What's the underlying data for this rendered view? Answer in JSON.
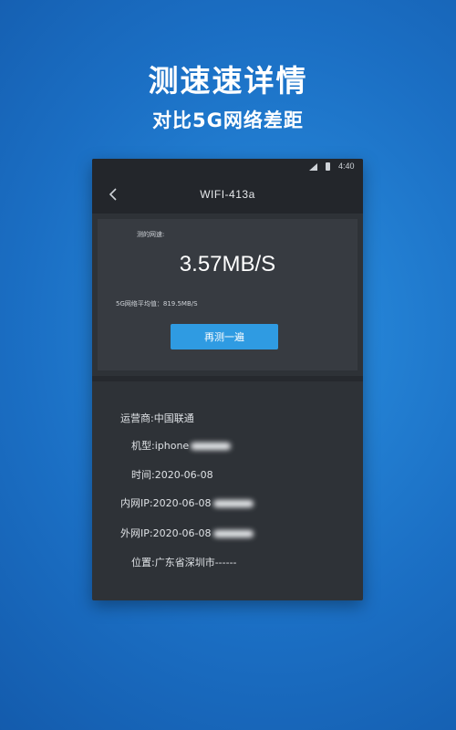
{
  "promo": {
    "title": "测速速详情",
    "subtitle": "对比5G网络差距"
  },
  "status_bar": {
    "time": "4:40"
  },
  "nav": {
    "title": "WIFI-413a"
  },
  "speed": {
    "label": "测的网速:",
    "value": "3.57MB/S",
    "avg_5g": "5G网络平均值：819.5MB/S",
    "retest_button": "再测一遍"
  },
  "info": {
    "carrier": "运营商:中国联通",
    "model": "机型:iphone",
    "time": "时间:2020-06-08",
    "lan_ip": "内网IP:2020-06-08",
    "wan_ip": "外网IP:2020-06-08",
    "location": "位置:广东省深圳市------"
  },
  "colors": {
    "accent_button": "#2f9be2",
    "panel_background": "#2e3237",
    "background_blue": "#1b6fc4"
  }
}
